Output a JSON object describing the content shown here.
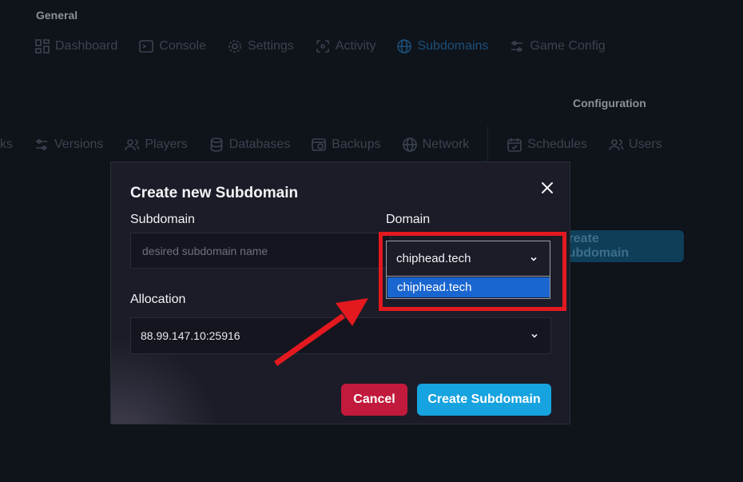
{
  "background": {
    "general_section_label": "General",
    "configuration_section_label": "Configuration",
    "top_nav": [
      {
        "label": "Dashboard",
        "icon": "dashboard-icon"
      },
      {
        "label": "Console",
        "icon": "console-icon"
      },
      {
        "label": "Settings",
        "icon": "gear-icon"
      },
      {
        "label": "Activity",
        "icon": "activity-icon"
      },
      {
        "label": "Subdomains",
        "icon": "globe-icon",
        "active": true
      },
      {
        "label": "Game Config",
        "icon": "sliders-icon"
      }
    ],
    "second_nav": [
      {
        "label": "ks",
        "icon": ""
      },
      {
        "label": "Versions",
        "icon": "sliders-icon"
      },
      {
        "label": "Players",
        "icon": "users-icon"
      },
      {
        "label": "Databases",
        "icon": "database-icon"
      },
      {
        "label": "Backups",
        "icon": "backup-icon"
      },
      {
        "label": "Network",
        "icon": "globe-icon"
      }
    ],
    "config_nav": [
      {
        "label": "Schedules",
        "icon": "calendar-icon"
      },
      {
        "label": "Users",
        "icon": "users-icon"
      }
    ],
    "create_button_label": "Create Subdomain"
  },
  "modal": {
    "title": "Create new Subdomain",
    "subdomain": {
      "label": "Subdomain",
      "value": "",
      "placeholder": "desired subdomain name"
    },
    "domain": {
      "label": "Domain",
      "selected": "chiphead.tech",
      "options": [
        "chiphead.tech"
      ]
    },
    "allocation": {
      "label": "Allocation",
      "selected": "88.99.147.10:25916"
    },
    "cancel_label": "Cancel",
    "submit_label": "Create Subdomain"
  },
  "colors": {
    "annotation_red": "#e3191f",
    "primary": "#16a3df",
    "danger": "#c21a3c",
    "option_highlight": "#1a66d0"
  }
}
